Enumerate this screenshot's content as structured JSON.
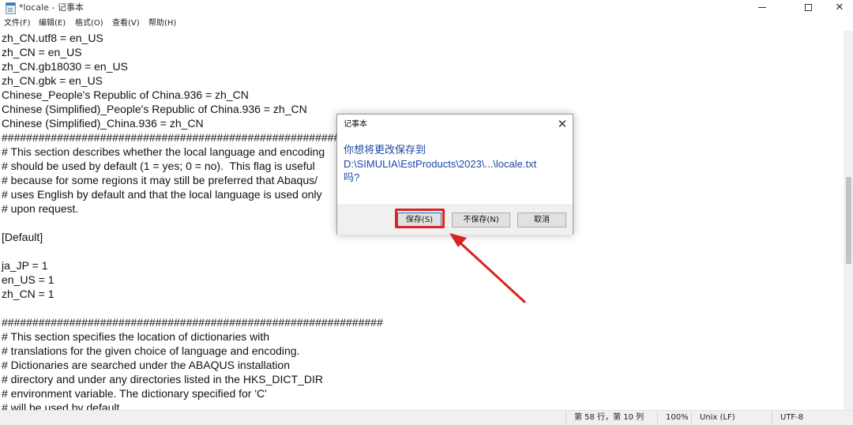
{
  "window": {
    "title": "*locale - 记事本",
    "controls": {
      "minimize": "min-icon",
      "maximize": "max-icon",
      "close": "✕"
    }
  },
  "menu": {
    "items": [
      "文件(F)",
      "编辑(E)",
      "格式(O)",
      "查看(V)",
      "帮助(H)"
    ]
  },
  "editor": {
    "lines": [
      "zh_CN.utf8 = en_US",
      "zh_CN = en_US",
      "zh_CN.gb18030 = en_US",
      "zh_CN.gbk = en_US",
      "Chinese_People's Republic of China.936 = zh_CN",
      "Chinese (Simplified)_People's Republic of China.936 = zh_CN",
      "Chinese (Simplified)_China.936 = zh_CN",
      "##############################################################",
      "# This section describes whether the local language and encoding",
      "# should be used by default (1 = yes; 0 = no).  This flag is useful",
      "# because for some regions it may still be preferred that Abaqus/",
      "# uses English by default and that the local language is used only",
      "# upon request.",
      "",
      "[Default]",
      "",
      "ja_JP = 1",
      "en_US = 1",
      "zh_CN = 1",
      "",
      "##############################################################",
      "# This section specifies the location of dictionaries with",
      "# translations for the given choice of language and encoding.",
      "# Dictionaries are searched under the ABAQUS installation",
      "# directory and under any directories listed in the HKS_DICT_DIR",
      "# environment variable. The dictionary specified for 'C'",
      "# will be used by default."
    ]
  },
  "status": {
    "position": "第 58 行，第 10 列",
    "zoom": "100%",
    "line_ending": "Unix (LF)",
    "encoding": "UTF-8"
  },
  "dialog": {
    "title": "记事本",
    "close": "✕",
    "message": "你想将更改保存到\nD:\\SIMULIA\\EstProducts\\2023\\...\\locale.txt\n吗?",
    "buttons": {
      "save": "保存(S)",
      "dont_save": "不保存(N)",
      "cancel": "取消"
    }
  },
  "annotation": {
    "color": "#d9241f"
  }
}
